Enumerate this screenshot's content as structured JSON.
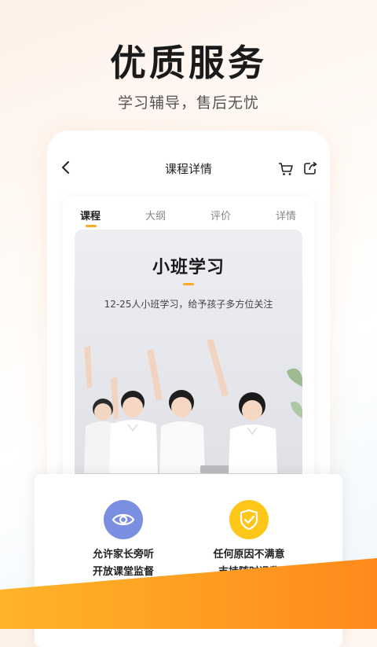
{
  "hero": {
    "title": "优质服务",
    "subtitle": "学习辅导，售后无忧"
  },
  "nav": {
    "title": "课程详情",
    "back_icon": "chevron-left-icon",
    "cart_icon": "cart-icon",
    "share_icon": "share-icon"
  },
  "tabs": [
    {
      "label": "课程",
      "active": true
    },
    {
      "label": "大纲",
      "active": false
    },
    {
      "label": "评价",
      "active": false
    },
    {
      "label": "详情",
      "active": false
    }
  ],
  "banner": {
    "title": "小班学习",
    "description": "12-25人小班学习，给予孩子多方位关注",
    "image": "students-raising-hands"
  },
  "features": [
    {
      "icon": "eye-icon",
      "color": "#7b8fe0",
      "line1": "允许家长旁听",
      "line2": "开放课堂监督"
    },
    {
      "icon": "shield-check-icon",
      "color": "#ffc61a",
      "line1": "任何原因不满意",
      "line2": "支持随时退费"
    }
  ],
  "colors": {
    "accent": "#ffa726",
    "wave": "#ff9a1f"
  }
}
